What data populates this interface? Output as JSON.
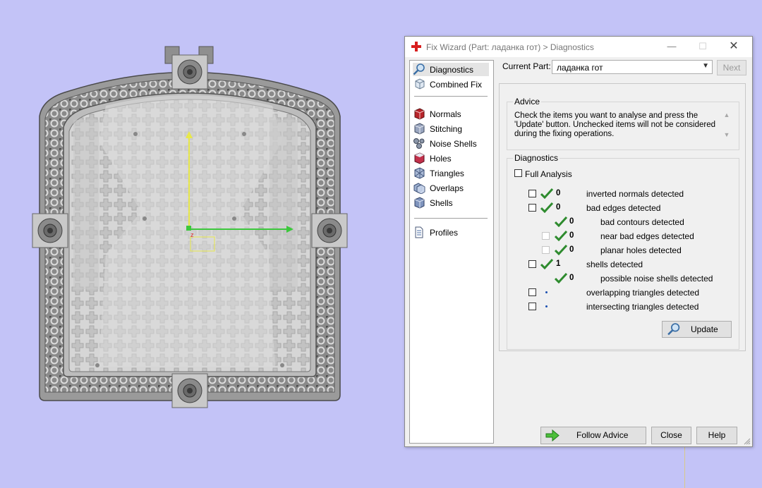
{
  "window": {
    "title": "Fix Wizard (Part: ладанка гот) > Diagnostics",
    "close_glyph": "✕",
    "minimize_glyph": "—",
    "maximize_glyph": "☐"
  },
  "viewport": {
    "axis_label": "z",
    "colors": {
      "background": "#c3c3f7",
      "y_axis": "#e8e84a",
      "x_axis": "#3cc83c",
      "z_axis": "#e03030"
    }
  },
  "nav": {
    "items": [
      {
        "label": "Diagnostics",
        "icon": "magnifier-icon",
        "selected": true
      },
      {
        "label": "Combined Fix",
        "icon": "combined-fix-icon"
      },
      {
        "label": "Normals",
        "icon": "normals-cube-icon"
      },
      {
        "label": "Stitching",
        "icon": "stitching-cube-icon"
      },
      {
        "label": "Noise Shells",
        "icon": "noise-shells-icon"
      },
      {
        "label": "Holes",
        "icon": "holes-cube-icon"
      },
      {
        "label": "Triangles",
        "icon": "triangles-cube-icon"
      },
      {
        "label": "Overlaps",
        "icon": "overlaps-cube-icon"
      },
      {
        "label": "Shells",
        "icon": "shells-cube-icon"
      },
      {
        "label": "Profiles",
        "icon": "profiles-document-icon"
      }
    ]
  },
  "current_part": {
    "label": "Current Part:",
    "value": "ладанка гот",
    "next_label": "Next"
  },
  "advice": {
    "legend": "Advice",
    "text": "Check the items you want to analyse and press the 'Update' button. Unchecked items will not be considered during the fixing operations."
  },
  "diagnostics": {
    "legend": "Diagnostics",
    "full_analysis_label": "Full Analysis",
    "rows": [
      {
        "count": "0",
        "label": "inverted normals detected",
        "status": "ok"
      },
      {
        "count": "0",
        "label": "bad edges detected",
        "status": "ok"
      },
      {
        "count": "0",
        "label": "bad contours detected",
        "status": "ok"
      },
      {
        "count": "0",
        "label": "near bad edges detected",
        "status": "ok"
      },
      {
        "count": "0",
        "label": "planar holes detected",
        "status": "ok"
      },
      {
        "count": "1",
        "label": "shells detected",
        "status": "ok"
      },
      {
        "count": "0",
        "label": "possible noise shells detected",
        "status": "ok"
      },
      {
        "count": "",
        "label": "overlapping triangles detected",
        "status": "pending"
      },
      {
        "count": "",
        "label": "intersecting triangles detected",
        "status": "pending"
      }
    ],
    "update_label": "Update",
    "check_color": "#2e8b2e",
    "pending_color": "#1a4fb0"
  },
  "footer": {
    "follow_advice_label": "Follow Advice",
    "close_label": "Close",
    "help_label": "Help"
  }
}
